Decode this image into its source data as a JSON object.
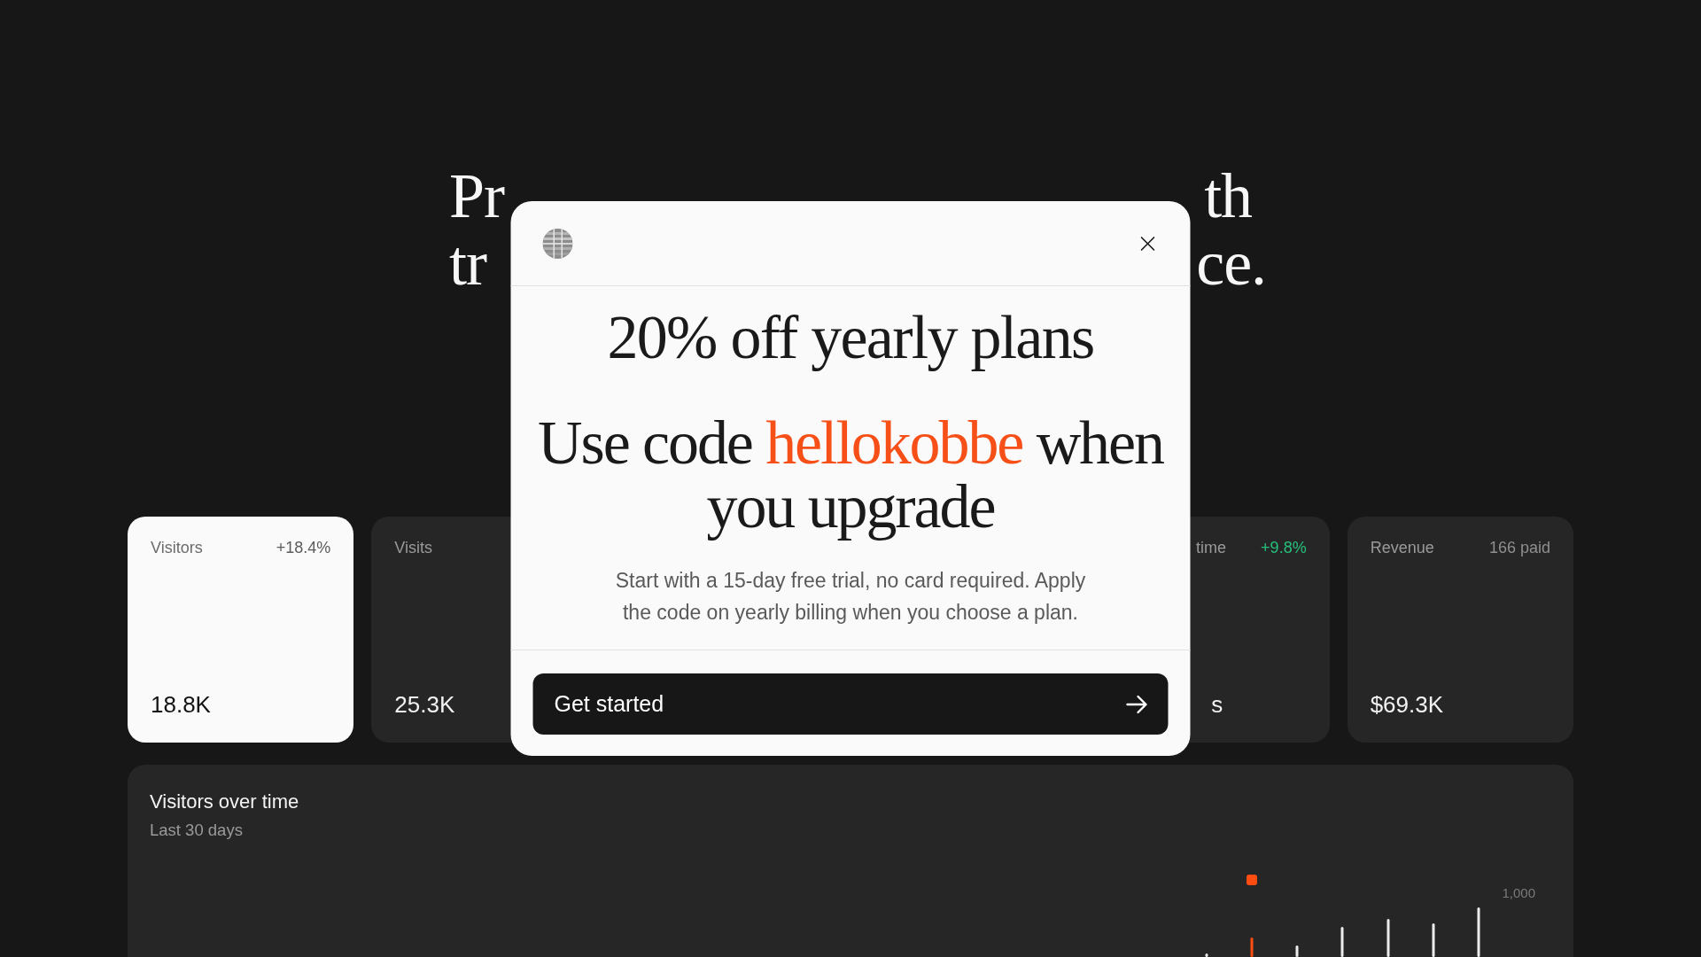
{
  "hero": {
    "headline_line_1_start": "Pr",
    "headline_line_1_end": "th",
    "headline_line_2_start": "tr",
    "headline_line_2_end": "ce."
  },
  "stat_cards": [
    {
      "label": "Visitors",
      "delta": "+18.4%",
      "delta_accent": false,
      "value": "18.8K",
      "selected": true
    },
    {
      "label": "Visits",
      "value": "25.3K",
      "selected": false
    },
    {
      "label": "time",
      "delta": "+9.8%",
      "delta_accent": true,
      "value": "s",
      "selected": false
    },
    {
      "label": "Revenue",
      "delta": "166 paid",
      "delta_accent": false,
      "value": "$69.3K",
      "selected": false
    }
  ],
  "visitors_chart": {
    "title": "Visitors over time",
    "subtitle": "Last 30 days",
    "axis_label": "1,000"
  },
  "promo_modal": {
    "title": "20% off yearly plans",
    "promo_before": "Use code",
    "promo_code": "hellokobbe",
    "promo_after": "when you upgrade",
    "description": "Start with a 15-day free trial, no card required. Apply the code on yearly billing when you choose a plan.",
    "button": "Get started"
  }
}
